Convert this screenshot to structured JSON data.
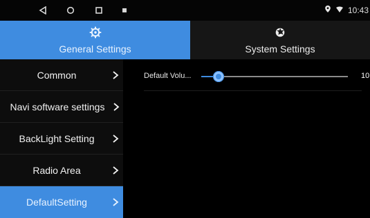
{
  "status_bar": {
    "time": "10:43"
  },
  "tabs": [
    {
      "label": "General Settings",
      "icon": "gear-icon",
      "active": true
    },
    {
      "label": "System Settings",
      "icon": "settings-system-icon",
      "active": false
    }
  ],
  "sidebar": {
    "items": [
      {
        "label": "Common",
        "active": false
      },
      {
        "label": "Navi software settings",
        "active": false
      },
      {
        "label": "BackLight Setting",
        "active": false
      },
      {
        "label": "Radio Area",
        "active": false
      },
      {
        "label": "DefaultSetting",
        "active": true
      }
    ]
  },
  "main": {
    "default_volume": {
      "label": "Default Volu...",
      "value": "10",
      "level": 0.12
    }
  },
  "colors": {
    "accent": "#3f8ce0",
    "background": "#000000",
    "inactive_tab": "#161616"
  }
}
